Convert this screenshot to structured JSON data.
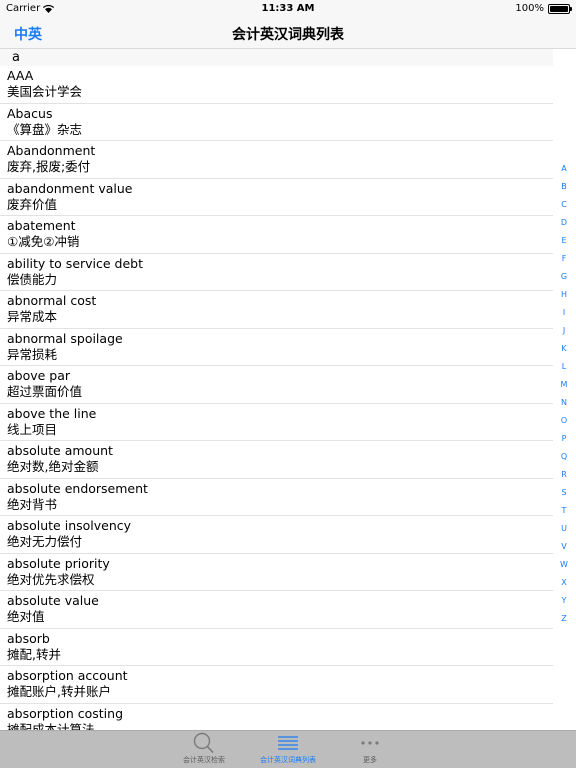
{
  "status_bar": {
    "carrier": "Carrier",
    "time": "11:33 AM",
    "battery": "100%",
    "battery_level": 1.0
  },
  "nav": {
    "left_label": "中英",
    "title": "会计英汉词典列表"
  },
  "section": {
    "header": "a"
  },
  "entries": [
    {
      "en": "AAA",
      "zh": "美国会计学会"
    },
    {
      "en": "Abacus",
      "zh": "《算盘》杂志"
    },
    {
      "en": "Abandonment",
      "zh": "废弃,报废;委付"
    },
    {
      "en": "abandonment value",
      "zh": "废弃价值"
    },
    {
      "en": "abatement",
      "zh": "①减免②冲销"
    },
    {
      "en": "ability to service debt",
      "zh": "偿债能力"
    },
    {
      "en": "abnormal cost",
      "zh": "异常成本"
    },
    {
      "en": "abnormal spoilage",
      "zh": "异常损耗"
    },
    {
      "en": "above par",
      "zh": "超过票面价值"
    },
    {
      "en": "above the line",
      "zh": "线上项目"
    },
    {
      "en": "absolute amount",
      "zh": "绝对数,绝对金额"
    },
    {
      "en": "absolute endorsement",
      "zh": "绝对背书"
    },
    {
      "en": "absolute insolvency",
      "zh": "绝对无力偿付"
    },
    {
      "en": "absolute priority",
      "zh": "绝对优先求偿权"
    },
    {
      "en": "absolute value",
      "zh": "绝对值"
    },
    {
      "en": "absorb",
      "zh": "摊配,转并"
    },
    {
      "en": "absorption account",
      "zh": "摊配账户,转并账户"
    },
    {
      "en": "absorption costing",
      "zh": "摊配成本计算法"
    }
  ],
  "index_letters": [
    "A",
    "B",
    "C",
    "D",
    "E",
    "F",
    "G",
    "H",
    "I",
    "J",
    "K",
    "L",
    "M",
    "N",
    "O",
    "P",
    "Q",
    "R",
    "S",
    "T",
    "U",
    "V",
    "W",
    "X",
    "Y",
    "Z"
  ],
  "tabs": [
    {
      "label": "会计英汉检索",
      "icon": "search-icon"
    },
    {
      "label": "会计英汉词典列表",
      "icon": "list-icon"
    },
    {
      "label": "更多",
      "icon": "more-icon"
    }
  ],
  "colors": {
    "accent": "#1a7cf5",
    "bar_bg": "#f7f7f7",
    "tab_bg": "#bdbdbd"
  }
}
